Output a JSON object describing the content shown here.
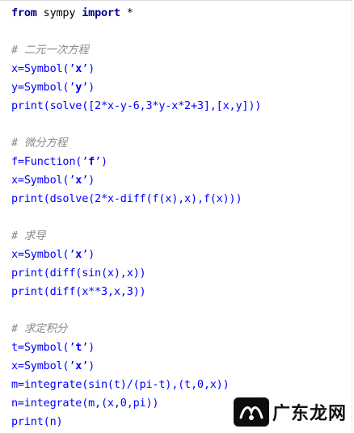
{
  "lines": [
    {
      "type": "import",
      "kw1": "from",
      "mid": " sympy ",
      "kw2": "import",
      "tail": " *"
    },
    {
      "type": "blank"
    },
    {
      "type": "comment",
      "text": "# 二元一次方程"
    },
    {
      "type": "assign",
      "name": "x=Symbol(",
      "arg": "x",
      "close": ")"
    },
    {
      "type": "assign",
      "name": "y=Symbol(",
      "arg": "y",
      "close": ")"
    },
    {
      "type": "code",
      "text": "print(solve([2*x-y-6,3*y-x*2+3],[x,y]))"
    },
    {
      "type": "blank"
    },
    {
      "type": "comment",
      "text": "# 微分方程"
    },
    {
      "type": "assign",
      "name": "f=Function(",
      "arg": "f",
      "close": ")"
    },
    {
      "type": "assign",
      "name": "x=Symbol(",
      "arg": "x",
      "close": ")"
    },
    {
      "type": "code",
      "text": "print(dsolve(2*x-diff(f(x),x),f(x)))"
    },
    {
      "type": "blank"
    },
    {
      "type": "comment",
      "text": "# 求导"
    },
    {
      "type": "assign",
      "name": "x=Symbol(",
      "arg": "x",
      "close": ")"
    },
    {
      "type": "code",
      "text": "print(diff(sin(x),x))"
    },
    {
      "type": "code",
      "text": "print(diff(x**3,x,3))"
    },
    {
      "type": "blank"
    },
    {
      "type": "comment",
      "text": "# 求定积分"
    },
    {
      "type": "assign",
      "name": "t=Symbol(",
      "arg": "t",
      "close": ")"
    },
    {
      "type": "assign",
      "name": "x=Symbol(",
      "arg": "x",
      "close": ")"
    },
    {
      "type": "code",
      "text": "m=integrate(sin(t)/(pi-t),(t,0,x))"
    },
    {
      "type": "code",
      "text": "n=integrate(m,(x,0,pi))"
    },
    {
      "type": "code",
      "text": "print(n)"
    }
  ],
  "watermark": {
    "text": "广东龙网",
    "icon": "logo-badge-icon"
  },
  "colors": {
    "code": "#0000ff",
    "keyword": "#00008b",
    "comment": "#8a8a8a"
  }
}
